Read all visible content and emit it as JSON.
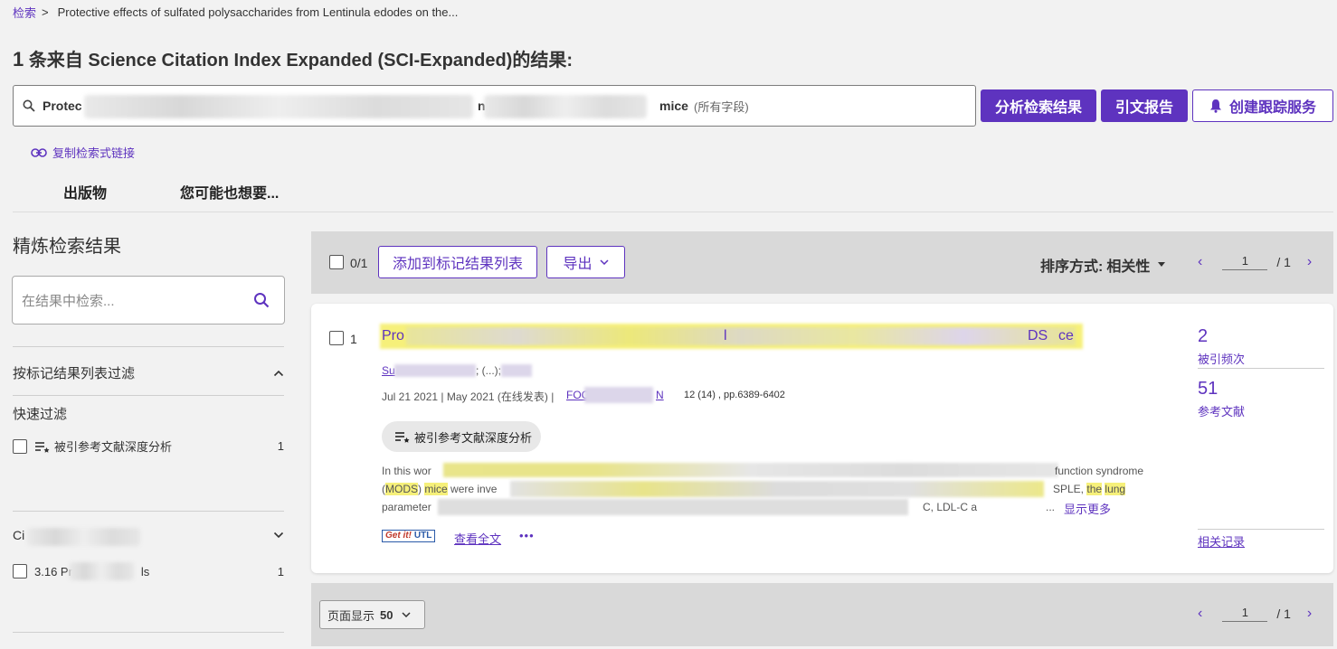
{
  "breadcrumb": {
    "root": "检索",
    "separator": ">",
    "current": "Protective effects of sulfated polysaccharides from Lentinula edodes on the..."
  },
  "header": {
    "count": "1",
    "title": "条来自 Science Citation Index Expanded (SCI-Expanded)的结果:"
  },
  "search": {
    "query_start": "Protec",
    "query_mid": "n f",
    "query_end": "mice",
    "field": "(所有字段)"
  },
  "actions": {
    "analyze": "分析检索结果",
    "citation_report": "引文报告",
    "create_alert": "创建跟踪服务"
  },
  "copy_link": "复制检索式链接",
  "tabs": [
    "出版物",
    "您可能也想要..."
  ],
  "refine": {
    "title": "精炼检索结果",
    "search_placeholder": "在结果中检索...",
    "marked_filter": "按标记结果列表过滤",
    "quick_filter": "快速过滤",
    "quick_items": [
      {
        "label": "被引参考文献深度分析",
        "count": "1"
      }
    ],
    "category_head": "Ci",
    "category_items": [
      {
        "label_start": "3.16 Pr",
        "label_end": "ls",
        "count": "1"
      }
    ]
  },
  "toolbar": {
    "selected": "0/1",
    "add_to_marked": "添加到标记结果列表",
    "export": "导出",
    "sort_label": "排序方式:",
    "sort_value": "相关性",
    "page": "1",
    "total_pages": "/ 1"
  },
  "record": {
    "index": "1",
    "title_start": "Pro",
    "title_mid1": "l",
    "title_mid2": "DS",
    "title_end": "ce",
    "authors_start": "Su",
    "authors_mid": "; (...);",
    "dates": "Jul 21 2021 | May 2021 (在线发表) |",
    "journal_start": "FOC",
    "journal_end": "N",
    "volume": "12 (14) , pp.6389-6402",
    "deep_analysis": "被引参考文献深度分析",
    "abstract_line1_start": "In this wor",
    "abstract_line1_end": "function syndrome",
    "abstract_line2_a": "(",
    "abstract_line2_mods": "MODS",
    "abstract_line2_b": ")",
    "abstract_line2_mice": "mice",
    "abstract_line2_c": "were inve",
    "abstract_line2_end_a": "SPLE,",
    "abstract_line2_the": "the",
    "abstract_line2_lung": "lung",
    "abstract_line3_start": "parameter",
    "abstract_line3_end": "C, LDL-C a",
    "ellipsis": "...",
    "show_more": "显示更多",
    "getit_label": "Get it!",
    "getit_org": "UTL",
    "full_text": "查看全文",
    "more": "•••",
    "times_cited": "2",
    "times_cited_label": "被引频次",
    "references": "51",
    "references_label": "参考文献",
    "related": "相关记录"
  },
  "bottom": {
    "per_page_label": "页面显示",
    "per_page_value": "50",
    "page": "1",
    "total_pages": "/ 1"
  },
  "colors": {
    "accent": "#5e33bf",
    "highlight": "#f6f07a",
    "toolbar_bg": "#d9d9d9"
  }
}
